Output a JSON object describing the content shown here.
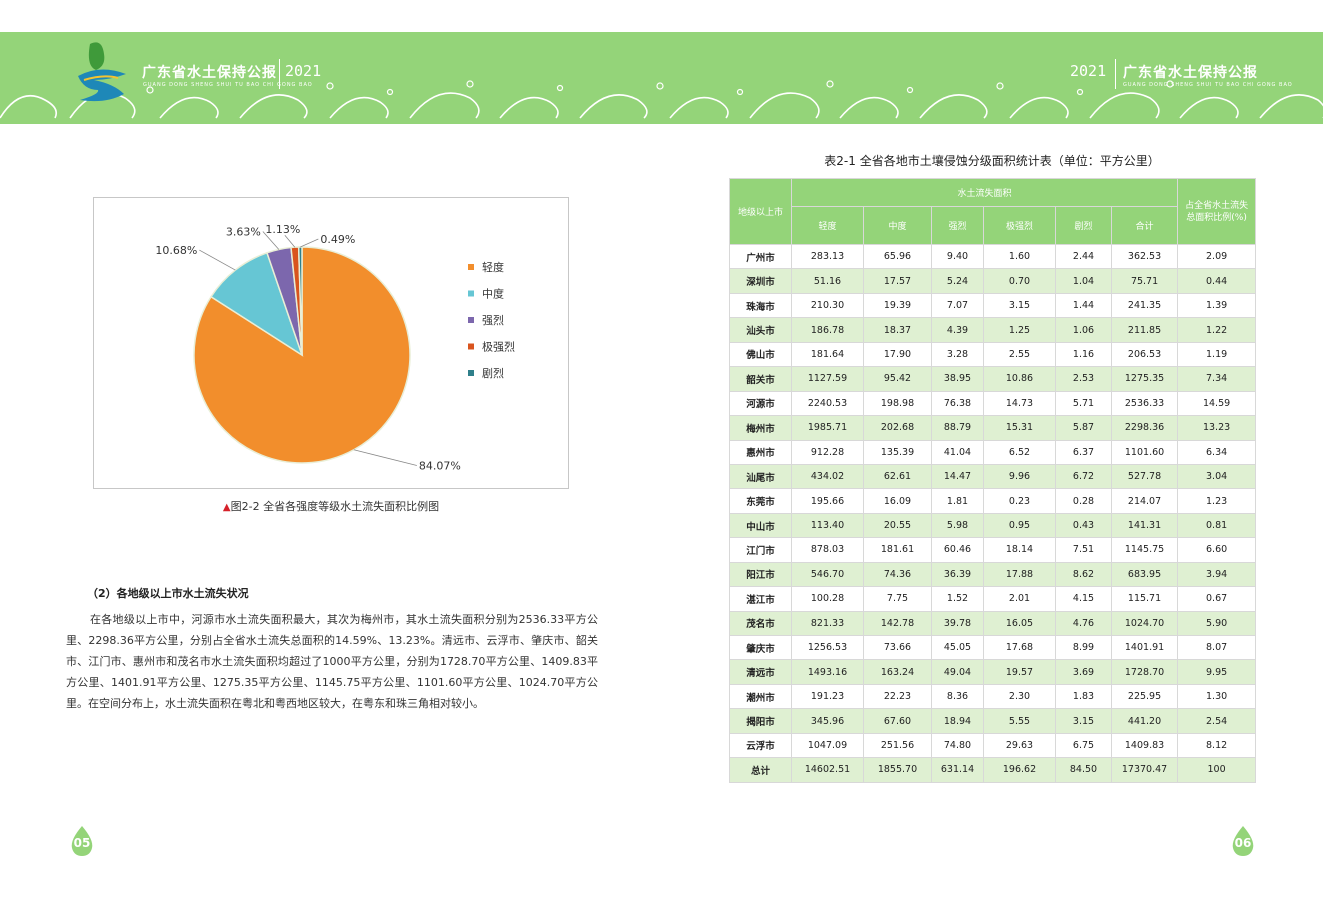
{
  "header": {
    "left_title": "广东省水土保持公报",
    "left_year": "2021",
    "left_subtitle": "GUANG DONG SHENG SHUI TU BAO CHI GONG BAO",
    "right_year": "2021",
    "right_title": "广东省水土保持公报",
    "right_subtitle": "GUANG DONG SHENG SHUI TU BAO CHI GONG BAO",
    "brand_color": "#94d479"
  },
  "chart_data": {
    "type": "pie",
    "categories": [
      "轻度",
      "中度",
      "强烈",
      "极强烈",
      "剧烈"
    ],
    "values": [
      84.07,
      10.68,
      3.63,
      1.13,
      0.49
    ],
    "value_labels": [
      "84.07%",
      "10.68%",
      "3.63%",
      "1.13%",
      "0.49%"
    ],
    "colors": [
      "#f28e2c",
      "#66c6d4",
      "#7c67ad",
      "#d9541e",
      "#2f7f8a"
    ],
    "legend_position": "right"
  },
  "figure_caption": {
    "marker": "▲",
    "text": "图2-2  全省各强度等级水土流失面积比例图"
  },
  "section": {
    "heading": "（2）各地级以上市水土流失状况",
    "paragraph": "在各地级以上市中，河源市水土流失面积最大，其次为梅州市，其水土流失面积分别为2536.33平方公里、2298.36平方公里，分别占全省水土流失总面积的14.59%、13.23%。清远市、云浮市、肇庆市、韶关市、江门市、惠州市和茂名市水土流失面积均超过了1000平方公里，分别为1728.70平方公里、1409.83平方公里、1401.91平方公里、1275.35平方公里、1145.75平方公里、1101.60平方公里、1024.70平方公里。在空间分布上，水土流失面积在粤北和粤西地区较大，在粤东和珠三角相对较小。"
  },
  "table": {
    "title": "表2-1  全省各地市土壤侵蚀分级面积统计表（单位：平方公里）",
    "header_city": "地级以上市",
    "header_group": "水土流失面积",
    "header_ratio": "占全省水土流失总面积比例(%)",
    "sub_headers": [
      "轻度",
      "中度",
      "强烈",
      "极强烈",
      "剧烈",
      "合计"
    ],
    "rows": [
      [
        "广州市",
        "283.13",
        "65.96",
        "9.40",
        "1.60",
        "2.44",
        "362.53",
        "2.09"
      ],
      [
        "深圳市",
        "51.16",
        "17.57",
        "5.24",
        "0.70",
        "1.04",
        "75.71",
        "0.44"
      ],
      [
        "珠海市",
        "210.30",
        "19.39",
        "7.07",
        "3.15",
        "1.44",
        "241.35",
        "1.39"
      ],
      [
        "汕头市",
        "186.78",
        "18.37",
        "4.39",
        "1.25",
        "1.06",
        "211.85",
        "1.22"
      ],
      [
        "佛山市",
        "181.64",
        "17.90",
        "3.28",
        "2.55",
        "1.16",
        "206.53",
        "1.19"
      ],
      [
        "韶关市",
        "1127.59",
        "95.42",
        "38.95",
        "10.86",
        "2.53",
        "1275.35",
        "7.34"
      ],
      [
        "河源市",
        "2240.53",
        "198.98",
        "76.38",
        "14.73",
        "5.71",
        "2536.33",
        "14.59"
      ],
      [
        "梅州市",
        "1985.71",
        "202.68",
        "88.79",
        "15.31",
        "5.87",
        "2298.36",
        "13.23"
      ],
      [
        "惠州市",
        "912.28",
        "135.39",
        "41.04",
        "6.52",
        "6.37",
        "1101.60",
        "6.34"
      ],
      [
        "汕尾市",
        "434.02",
        "62.61",
        "14.47",
        "9.96",
        "6.72",
        "527.78",
        "3.04"
      ],
      [
        "东莞市",
        "195.66",
        "16.09",
        "1.81",
        "0.23",
        "0.28",
        "214.07",
        "1.23"
      ],
      [
        "中山市",
        "113.40",
        "20.55",
        "5.98",
        "0.95",
        "0.43",
        "141.31",
        "0.81"
      ],
      [
        "江门市",
        "878.03",
        "181.61",
        "60.46",
        "18.14",
        "7.51",
        "1145.75",
        "6.60"
      ],
      [
        "阳江市",
        "546.70",
        "74.36",
        "36.39",
        "17.88",
        "8.62",
        "683.95",
        "3.94"
      ],
      [
        "湛江市",
        "100.28",
        "7.75",
        "1.52",
        "2.01",
        "4.15",
        "115.71",
        "0.67"
      ],
      [
        "茂名市",
        "821.33",
        "142.78",
        "39.78",
        "16.05",
        "4.76",
        "1024.70",
        "5.90"
      ],
      [
        "肇庆市",
        "1256.53",
        "73.66",
        "45.05",
        "17.68",
        "8.99",
        "1401.91",
        "8.07"
      ],
      [
        "清远市",
        "1493.16",
        "163.24",
        "49.04",
        "19.57",
        "3.69",
        "1728.70",
        "9.95"
      ],
      [
        "潮州市",
        "191.23",
        "22.23",
        "8.36",
        "2.30",
        "1.83",
        "225.95",
        "1.30"
      ],
      [
        "揭阳市",
        "345.96",
        "67.60",
        "18.94",
        "5.55",
        "3.15",
        "441.20",
        "2.54"
      ],
      [
        "云浮市",
        "1047.09",
        "251.56",
        "74.80",
        "29.63",
        "6.75",
        "1409.83",
        "8.12"
      ],
      [
        "总计",
        "14602.51",
        "1855.70",
        "631.14",
        "196.62",
        "84.50",
        "17370.47",
        "100"
      ]
    ]
  },
  "page_numbers": {
    "left": "05",
    "right": "06"
  }
}
